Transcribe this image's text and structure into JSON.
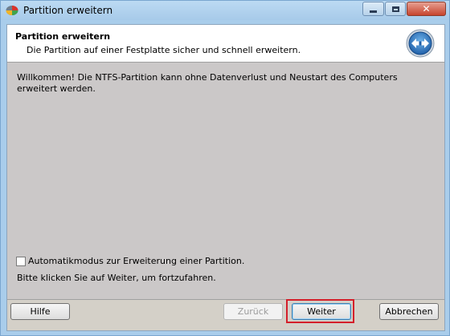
{
  "window": {
    "title": "Partition erweitern",
    "close_glyph": "✕"
  },
  "header": {
    "title": "Partition erweitern",
    "subtitle": "Die Partition auf einer Festplatte sicher und schnell erweitern."
  },
  "content": {
    "welcome": "Willkommen! Die NTFS-Partition kann ohne Datenverlust und Neustart des Computers erweitert werden.",
    "auto_mode_label": "Automatikmodus zur Erweiterung einer Partition.",
    "auto_mode_checked": false,
    "hint": "Bitte klicken Sie auf Weiter, um fortzufahren."
  },
  "buttons": {
    "help": "Hilfe",
    "back": "Zurück",
    "next": "Weiter",
    "cancel": "Abbrechen"
  },
  "icons": {
    "app": "partition-app-icon",
    "header": "resize-arrows-icon"
  },
  "colors": {
    "highlight": "#d41f2a",
    "header_icon_blue": "#1f5fa8"
  }
}
